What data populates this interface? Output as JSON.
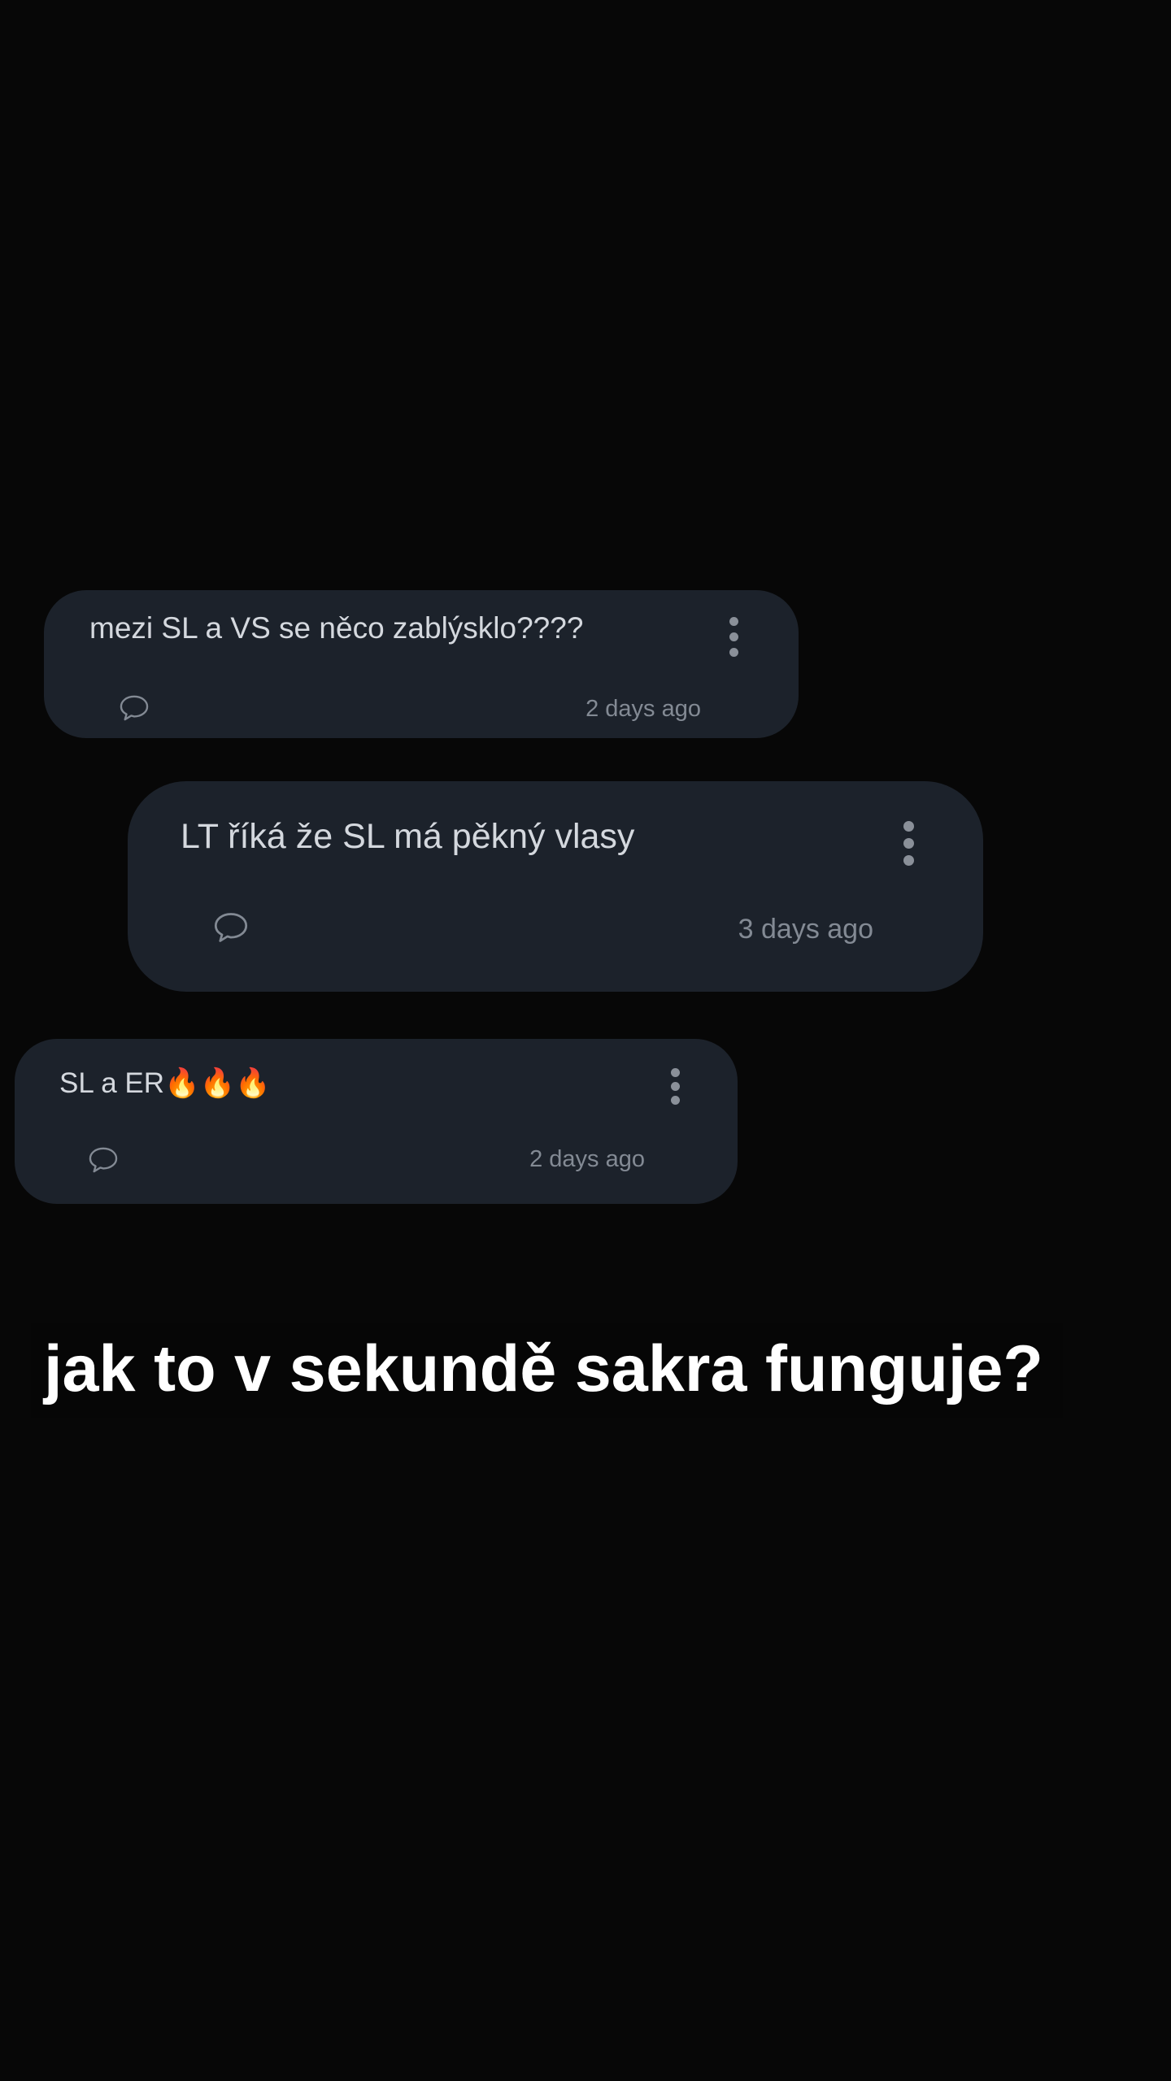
{
  "posts": [
    {
      "text": "mezi SL a VS se něco zablýsklo????",
      "time": "2 days ago",
      "comment_icon": "speech-bubble-icon",
      "menu_icon": "more-vertical-icon"
    },
    {
      "text": "LT říká že SL má pěkný vlasy",
      "time": "3 days ago",
      "comment_icon": "speech-bubble-icon",
      "menu_icon": "more-vertical-icon"
    },
    {
      "text": "SL a ER🔥🔥🔥",
      "time": "2 days ago",
      "comment_icon": "speech-bubble-icon",
      "menu_icon": "more-vertical-icon"
    }
  ],
  "caption": "jak to v sekundě sakra funguje?",
  "colors": {
    "background": "#070707",
    "card": "#1c222b",
    "post_text": "#d4d8de",
    "muted": "#838a94",
    "caption_text": "#ffffff"
  }
}
